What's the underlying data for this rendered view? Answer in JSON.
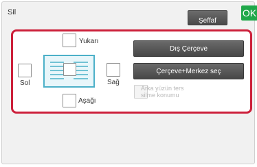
{
  "header": {
    "title": "Sil",
    "seffaf_label": "Şeffaf",
    "ok_label": "OK"
  },
  "positions": {
    "top_label": "Yukarı",
    "left_label": "Sol",
    "right_label": "Sağ",
    "bottom_label": "Aşağı"
  },
  "buttons": {
    "outer_frame_label": "Dış Çerçeve",
    "frame_center_label": "Çerçeve+Merkez seç"
  },
  "backside": {
    "label_line1": "Arka yüzün ters",
    "label_line2": "silme konumu"
  },
  "colors": {
    "accent_red": "#cc1f3a",
    "ok_green": "#20a84a",
    "doc_blue": "#4bb0c8"
  }
}
